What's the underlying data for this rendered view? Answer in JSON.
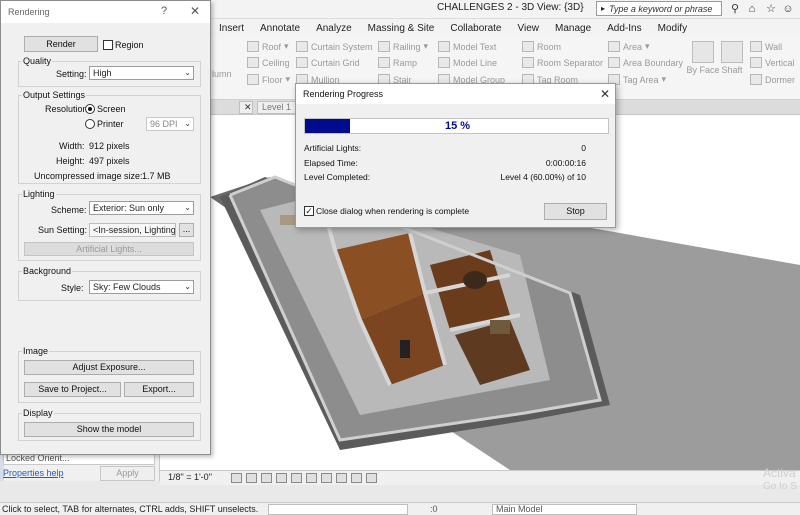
{
  "app": {
    "title": "CHALLENGES 2 - 3D View: {3D}",
    "search_placeholder": "Type a keyword or phrase"
  },
  "ribbon": {
    "tabs": [
      "Insert",
      "Annotate",
      "Analyze",
      "Massing & Site",
      "Collaborate",
      "View",
      "Manage",
      "Add-Ins",
      "Modify"
    ],
    "items": {
      "roof": "Roof",
      "ceiling": "Ceiling",
      "floor": "Floor",
      "column": "lumn",
      "curtain_system": "Curtain System",
      "curtain_grid": "Curtain Grid",
      "mullion": "Mullion",
      "railing": "Railing",
      "ramp": "Ramp",
      "stair": "Stair",
      "model_text": "Model Text",
      "model_line": "Model Line",
      "model_group": "Model Group",
      "room": "Room",
      "room_separator": "Room Separator",
      "tag_room": "Tag Room",
      "area": "Area",
      "area_boundary": "Area Boundary",
      "tag_area": "Tag Area",
      "by_face": "By Face",
      "shaft": "Shaft",
      "wall": "Wall",
      "vertical": "Vertical",
      "dormer": "Dormer"
    },
    "view_tab": "Level 1"
  },
  "rendering_dialog": {
    "title": "Rendering",
    "help": "?",
    "render_button": "Render",
    "region_label": "Region",
    "region_checked": false,
    "quality": {
      "group": "Quality",
      "setting_label": "Setting:",
      "setting_value": "High"
    },
    "output": {
      "group": "Output Settings",
      "resolution_label": "Resolution:",
      "screen_label": "Screen",
      "printer_label": "Printer",
      "selected": "Screen",
      "dpi_value": "96 DPI",
      "width_label": "Width:",
      "width_value": "912 pixels",
      "height_label": "Height:",
      "height_value": "497 pixels",
      "size_label": "Uncompressed image size:",
      "size_value": "1.7 MB"
    },
    "lighting": {
      "group": "Lighting",
      "scheme_label": "Scheme:",
      "scheme_value": "Exterior: Sun only",
      "sun_label": "Sun Setting:",
      "sun_value": "<In-session, Lighting>",
      "sun_more": "...",
      "artificial_button": "Artificial Lights..."
    },
    "background": {
      "group": "Background",
      "style_label": "Style:",
      "style_value": "Sky: Few Clouds"
    },
    "image": {
      "group": "Image",
      "adjust_button": "Adjust Exposure...",
      "save_button": "Save to Project...",
      "export_button": "Export..."
    },
    "display": {
      "group": "Display",
      "show_button": "Show the model"
    }
  },
  "progress_dialog": {
    "title": "Rendering Progress",
    "percent_text": "15 %",
    "progress_fraction": 0.15,
    "artificial_lights_label": "Artificial Lights:",
    "artificial_lights_value": "0",
    "elapsed_label": "Elapsed Time:",
    "elapsed_value": "0:00:00:16",
    "level_label": "Level Completed:",
    "level_value": "Level 4 (60.00%) of 10",
    "close_check_label": "Close dialog when rendering is complete",
    "close_checked": true,
    "stop_button": "Stop"
  },
  "properties": {
    "locked_orient": "Locked Orient...",
    "help_link": "Properties help",
    "apply_button": "Apply"
  },
  "view_control": {
    "scale": "1/8\" = 1'-0\""
  },
  "watermark": {
    "line1": "Activa",
    "line2": "Go to S"
  },
  "status_bar": {
    "message": "Click to select, TAB for alternates, CTRL adds, SHIFT unselects.",
    "zero": ":0",
    "model": "Main Model"
  },
  "colors": {
    "progress_fill": "#000b8e",
    "link": "#1f5fbf"
  }
}
